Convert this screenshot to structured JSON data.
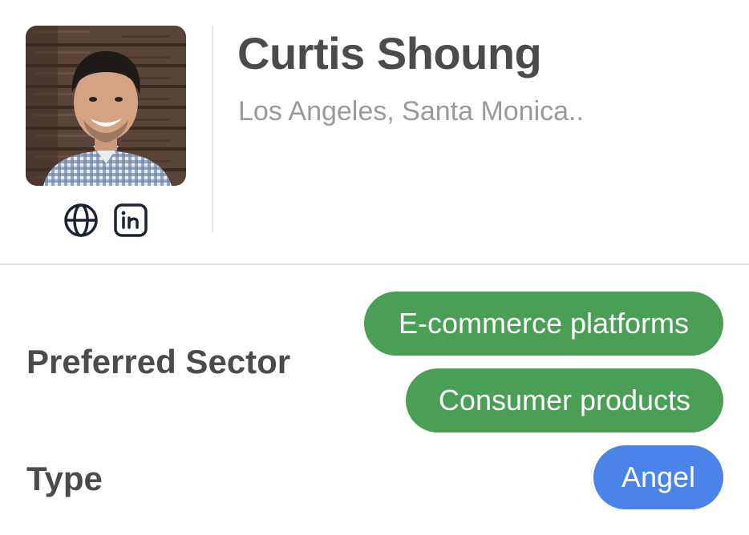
{
  "profile": {
    "name": "Curtis Shoung",
    "location": "Los Angeles, Santa Monica..",
    "photo_alt": "Profile photo"
  },
  "links": [
    {
      "icon": "globe-icon"
    },
    {
      "icon": "linkedin-icon"
    }
  ],
  "details": {
    "sector_label": "Preferred Sector",
    "sectors": [
      "E-commerce platforms",
      "Consumer products"
    ],
    "type_label": "Type",
    "type_value": "Angel"
  },
  "colors": {
    "sector_chip": "#4a9e56",
    "type_chip": "#4a84ea",
    "icon": "#1c2433"
  }
}
